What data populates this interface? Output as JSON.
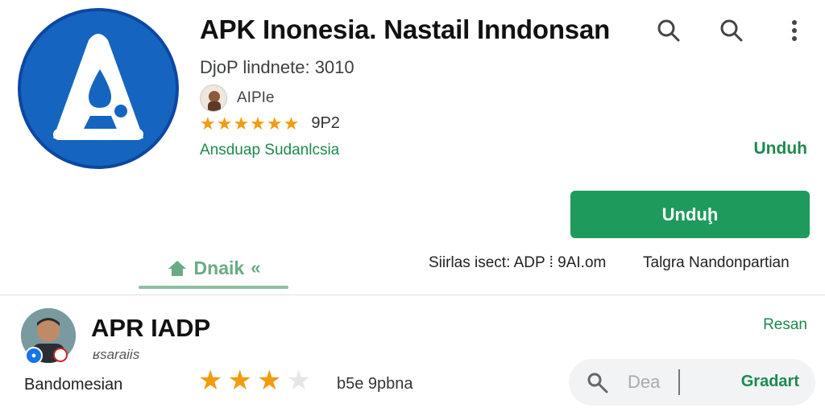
{
  "app": {
    "title": "APK Inonesia. Nastail Inndonsan",
    "subtitle": "DjoP lindnete: 3010",
    "developer": "AIPIe",
    "rating_count": "9P2",
    "stars": "★★★★★★",
    "link": "Ansduap Sudanlcsia",
    "icon_name": "apk-logo-icon"
  },
  "header_icons": [
    "search-icon",
    "search-icon",
    "more-vert-icon"
  ],
  "secondary_link": "Unduh",
  "install_button": "Unduḩ",
  "tabs": {
    "detail_label": "Dnaik",
    "info_left": "Siirlas isect: ADP ⁞ 9AI.om",
    "info_right": "Talgra Nandonpartian"
  },
  "review": {
    "name": "APR IADP",
    "sub": "ʁsaraiis",
    "label": "Bandomesian",
    "rating": 3,
    "max_rating": 4,
    "count": "b5e 9pbna",
    "link": "Resan"
  },
  "search_pill": {
    "text": "Dea",
    "action": "Gradart"
  },
  "colors": {
    "brand_green": "#1e9b5c",
    "icon_blue": "#1565c0",
    "star": "#f29b0c"
  }
}
